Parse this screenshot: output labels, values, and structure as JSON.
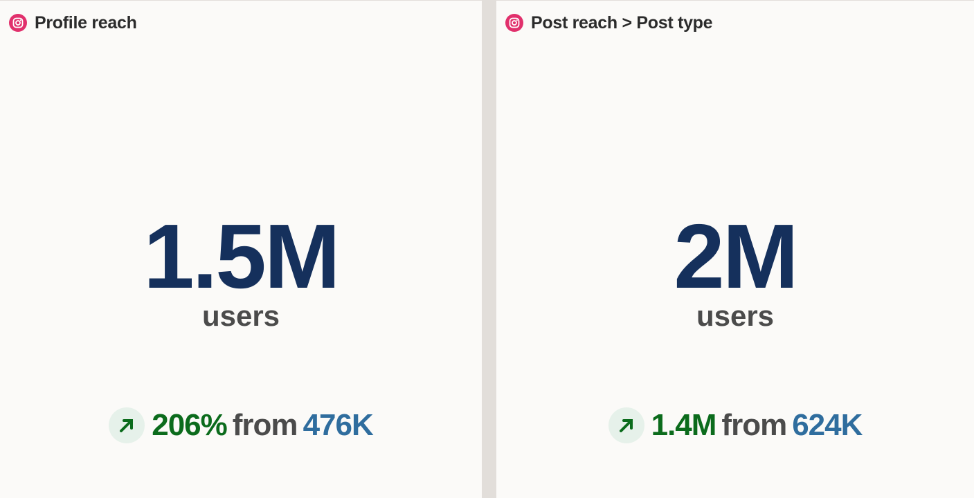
{
  "cards": [
    {
      "icon": "instagram-icon",
      "title": "Profile reach",
      "value": "1.5M",
      "unit": "users",
      "change": {
        "direction_icon": "arrow-up-right-icon",
        "value": "206%",
        "word": "from",
        "previous": "476K"
      }
    },
    {
      "icon": "instagram-icon",
      "title": "Post reach > Post type",
      "value": "2M",
      "unit": "users",
      "change": {
        "direction_icon": "arrow-up-right-icon",
        "value": "1.4M",
        "word": "from",
        "previous": "624K"
      }
    }
  ],
  "colors": {
    "instagram": "#e1306c",
    "metric": "#15305c",
    "increase": "#0b6b1c",
    "previous": "#2f6d9e",
    "muted_text": "#4b4b4b"
  }
}
